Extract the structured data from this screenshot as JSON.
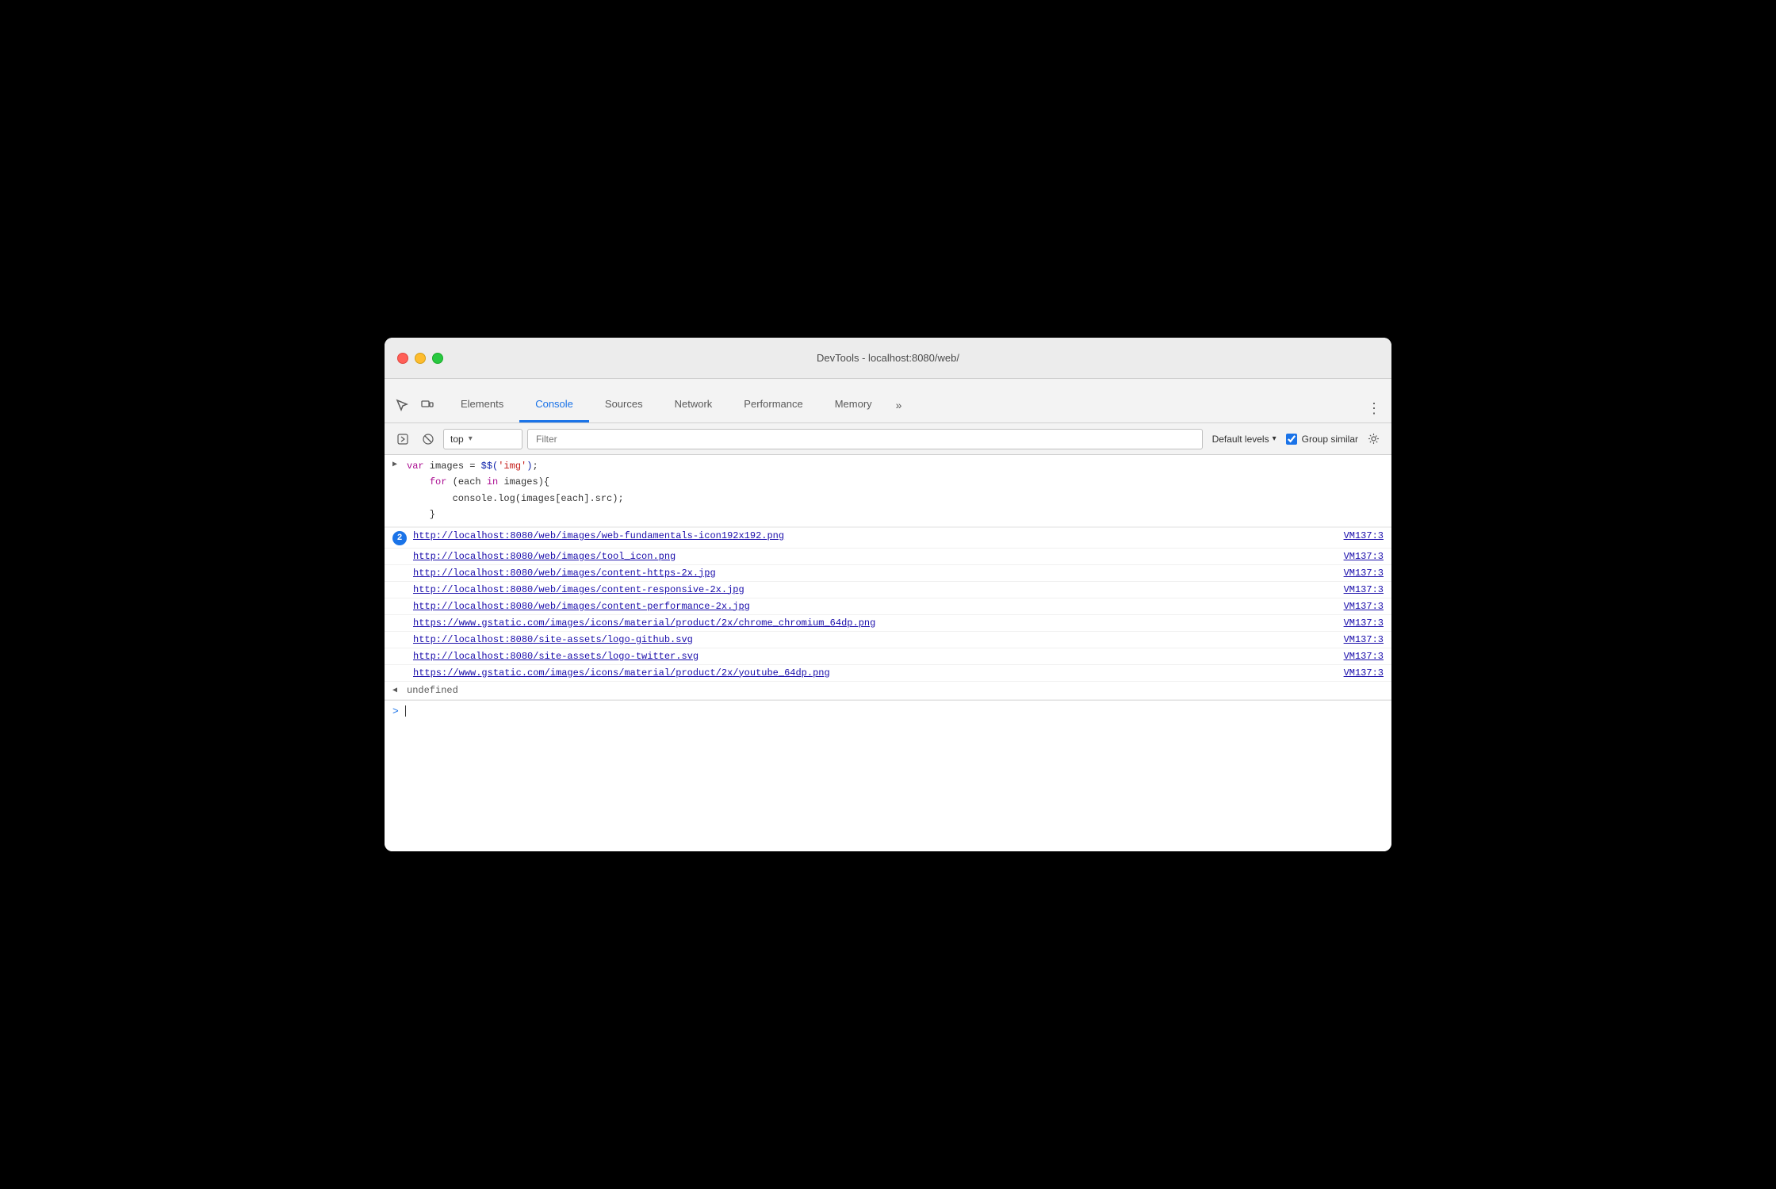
{
  "window": {
    "title": "DevTools - localhost:8080/web/"
  },
  "tabs": {
    "items": [
      {
        "id": "elements",
        "label": "Elements",
        "active": false
      },
      {
        "id": "console",
        "label": "Console",
        "active": true
      },
      {
        "id": "sources",
        "label": "Sources",
        "active": false
      },
      {
        "id": "network",
        "label": "Network",
        "active": false
      },
      {
        "id": "performance",
        "label": "Performance",
        "active": false
      },
      {
        "id": "memory",
        "label": "Memory",
        "active": false
      }
    ],
    "more_label": "»",
    "menu_icon": "⋮"
  },
  "toolbar": {
    "execute_label": "▶",
    "clear_label": "🚫",
    "context_value": "top",
    "filter_placeholder": "Filter",
    "levels_label": "Default levels",
    "group_similar_label": "Group similar",
    "group_similar_checked": true,
    "gear_label": "⚙"
  },
  "console": {
    "code": "var images = $$('img');\n    for (each in images){\n        console.log(images[each].src);\n    }",
    "badge_count": "2",
    "log_entries": [
      {
        "url": "http://localhost:8080/web/images/web-fundamentals-icon192x192.png",
        "source": "VM137:3",
        "has_badge": true
      },
      {
        "url": "http://localhost:8080/web/images/tool_icon.png",
        "source": "VM137:3",
        "has_badge": false
      },
      {
        "url": "http://localhost:8080/web/images/content-https-2x.jpg",
        "source": "VM137:3",
        "has_badge": false
      },
      {
        "url": "http://localhost:8080/web/images/content-responsive-2x.jpg",
        "source": "VM137:3",
        "has_badge": false
      },
      {
        "url": "http://localhost:8080/web/images/content-performance-2x.jpg",
        "source": "VM137:3",
        "has_badge": false
      },
      {
        "url": "https://www.gstatic.com/images/icons/material/product/2x/chrome_chromium_64dp.png",
        "source": "VM137:3",
        "has_badge": false
      },
      {
        "url": "http://localhost:8080/site-assets/logo-github.svg",
        "source": "VM137:3",
        "has_badge": false
      },
      {
        "url": "http://localhost:8080/site-assets/logo-twitter.svg",
        "source": "VM137:3",
        "has_badge": false
      },
      {
        "url": "https://www.gstatic.com/images/icons/material/product/2x/youtube_64dp.png",
        "source": "VM137:3",
        "has_badge": false
      }
    ],
    "undefined_text": "undefined",
    "prompt_arrow": ">"
  }
}
